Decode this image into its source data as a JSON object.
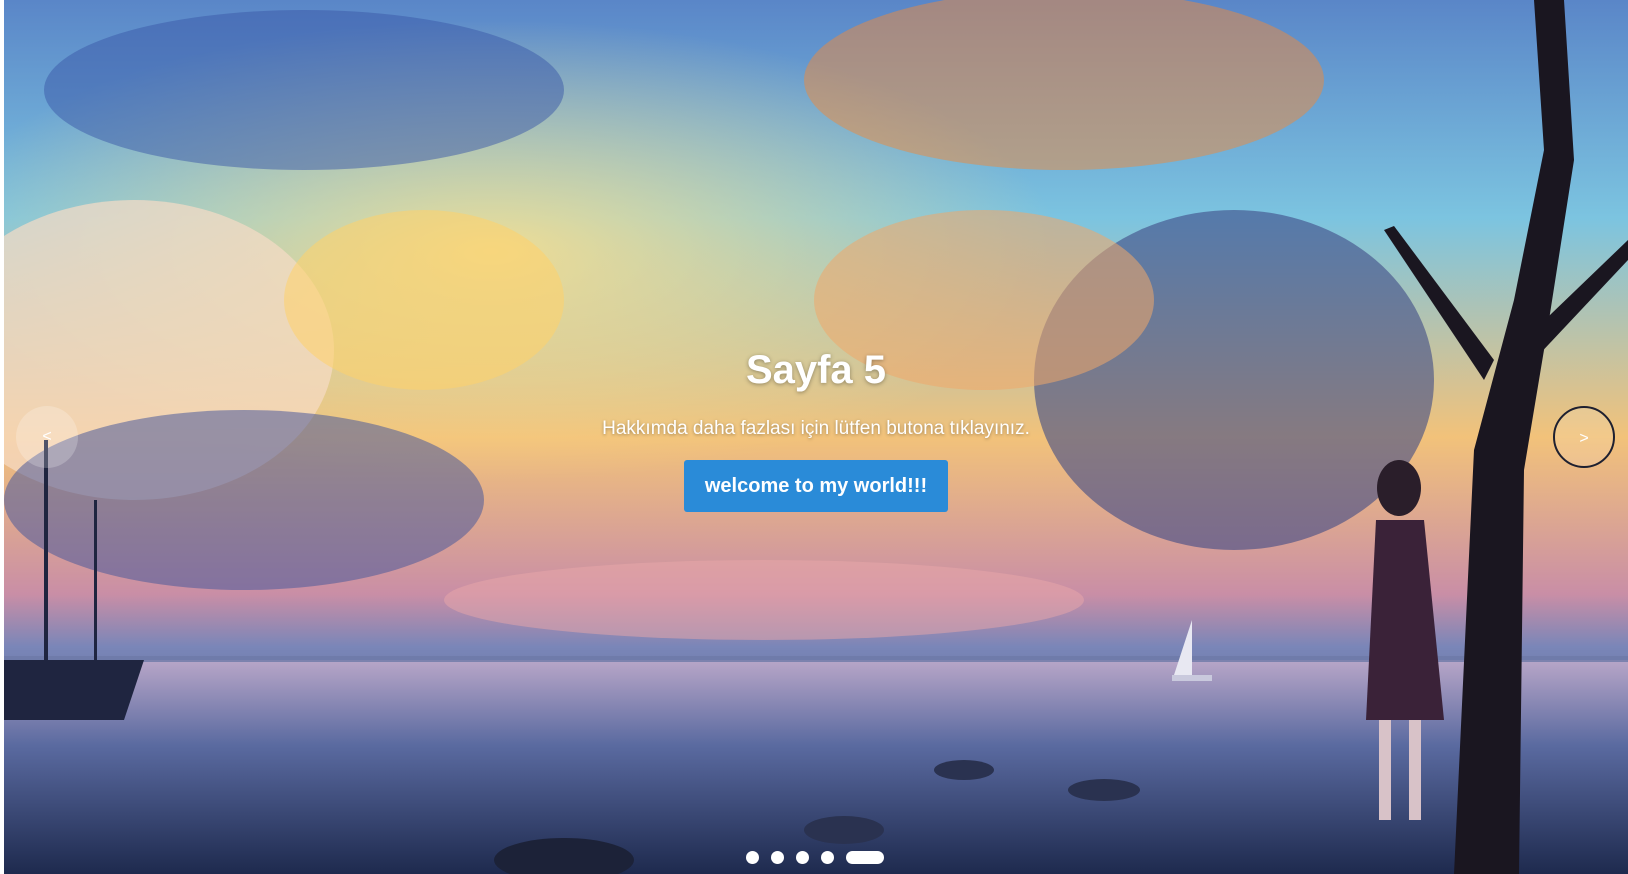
{
  "slide": {
    "title": "Sayfa 5",
    "subtitle": "Hakkımda daha fazlası için lütfen butona tıklayınız.",
    "button_label": "welcome to my world!!!"
  },
  "controls": {
    "prev_label": "<",
    "next_label": ">",
    "prev_icon": "chevron-left-icon",
    "next_icon": "chevron-right-icon"
  },
  "pagination": {
    "total": 5,
    "active_index": 4
  },
  "colors": {
    "button_bg": "#2a8bd8",
    "text": "#ffffff"
  }
}
